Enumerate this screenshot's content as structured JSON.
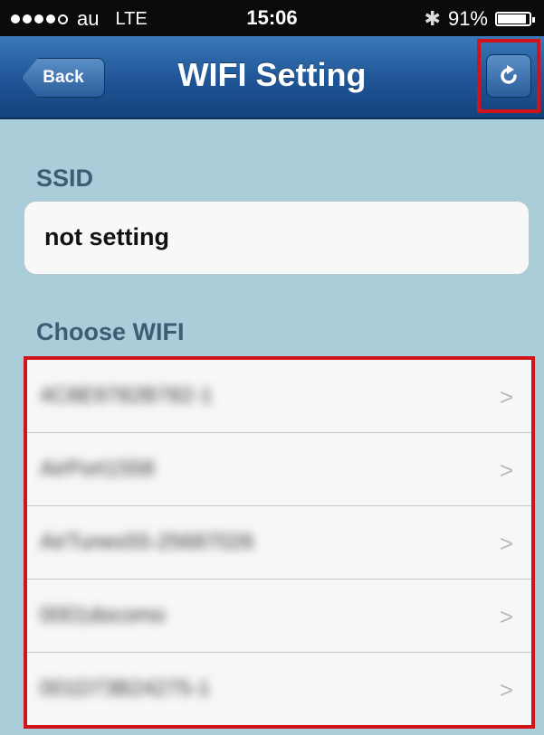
{
  "status_bar": {
    "carrier": "au",
    "network": "LTE",
    "time": "15:06",
    "battery": "91%",
    "battery_level": 0.91,
    "signal_bars": 4,
    "signal_max": 5
  },
  "nav": {
    "back_label": "Back",
    "title": "WIFI Setting",
    "refresh_icon": "refresh-icon",
    "bar_color": "#1f5496",
    "highlight_color": "#d0141a"
  },
  "ssid": {
    "label": "SSID",
    "value": "not setting"
  },
  "wifi_list": {
    "label": "Choose WIFI",
    "networks": [
      {
        "name": "4C8E9782B782-1"
      },
      {
        "name": "AirPort1558"
      },
      {
        "name": "AirTunes55-25687026"
      },
      {
        "name": "0001docomo"
      },
      {
        "name": "001D73B24275-1"
      }
    ],
    "chevron": ">"
  }
}
